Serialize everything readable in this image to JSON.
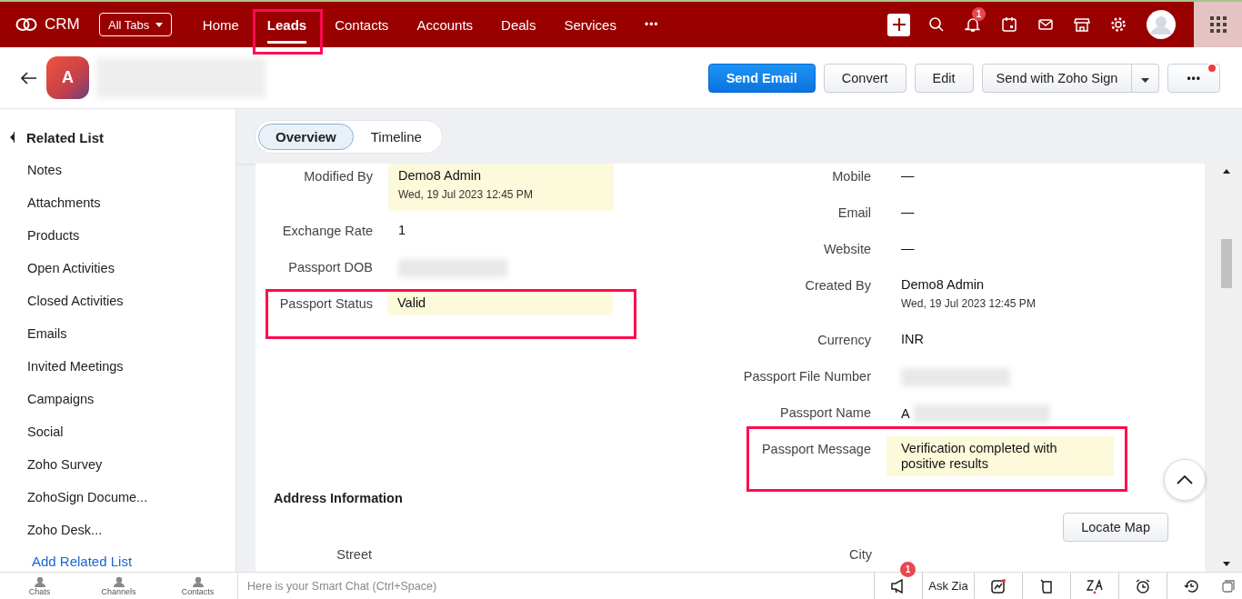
{
  "top_nav": {
    "logo_text": "CRM",
    "all_tabs": "All Tabs",
    "more": "•••",
    "notification_count": "1",
    "items": [
      {
        "label": "Home",
        "selected": false,
        "highlighted": false
      },
      {
        "label": "Leads",
        "selected": true,
        "highlighted": true
      },
      {
        "label": "Contacts",
        "selected": false,
        "highlighted": false
      },
      {
        "label": "Accounts",
        "selected": false,
        "highlighted": false
      },
      {
        "label": "Deals",
        "selected": false,
        "highlighted": false
      },
      {
        "label": "Services",
        "selected": false,
        "highlighted": false
      }
    ]
  },
  "record_header": {
    "avatar_letter": "A",
    "more": "•••",
    "more_has_alert": true,
    "actions": [
      {
        "label": "Send Email",
        "kind": "primary"
      },
      {
        "label": "Convert",
        "kind": "plain"
      },
      {
        "label": "Edit",
        "kind": "plain"
      },
      {
        "label": "Send with Zoho Sign",
        "kind": "split"
      }
    ]
  },
  "related_list": {
    "title": "Related List",
    "add_link": "Add Related List",
    "items": [
      "Notes",
      "Attachments",
      "Products",
      "Open Activities",
      "Closed Activities",
      "Emails",
      "Invited Meetings",
      "Campaigns",
      "Social",
      "Zoho Survey",
      "ZohoSign Docume...",
      "Zoho Desk..."
    ]
  },
  "view_tabs": [
    {
      "label": "Overview",
      "selected": true
    },
    {
      "label": "Timeline",
      "selected": false
    }
  ],
  "details": {
    "left": [
      {
        "label": "Modified By",
        "value": "Demo8 Admin",
        "subtext": "Wed, 19 Jul 2023 12:45 PM",
        "blurred": false,
        "tinted": true,
        "highlighted": false
      },
      {
        "label": "Exchange Rate",
        "value": "1",
        "blurred": false,
        "tinted": false,
        "highlighted": false
      },
      {
        "label": "Passport DOB",
        "blurred": true,
        "tinted": false,
        "highlighted": false
      },
      {
        "label": "Passport Status",
        "value": "Valid",
        "blurred": false,
        "tinted": true,
        "highlighted": true
      }
    ],
    "right": [
      {
        "label": "Mobile",
        "value": "—",
        "blurred": false,
        "tinted": false,
        "highlighted": false
      },
      {
        "label": "Email",
        "value": "—",
        "blurred": false,
        "tinted": false,
        "highlighted": false
      },
      {
        "label": "Website",
        "value": "—",
        "blurred": false,
        "tinted": false,
        "highlighted": false
      },
      {
        "label": "Created By",
        "value": "Demo8 Admin",
        "subtext": "Wed, 19 Jul 2023 12:45 PM",
        "blurred": false,
        "tinted": false,
        "highlighted": false
      },
      {
        "label": "Currency",
        "value": "INR",
        "blurred": false,
        "tinted": false,
        "highlighted": false
      },
      {
        "label": "Passport File Number",
        "blurred": true,
        "tinted": false,
        "highlighted": false
      },
      {
        "label": "Passport Name",
        "value": "A",
        "blurred": true,
        "tinted": false,
        "highlighted": false
      },
      {
        "label": "Passport Message",
        "value": "Verification completed with positive results",
        "blurred": false,
        "tinted": true,
        "highlighted": true
      }
    ]
  },
  "address_section": {
    "title": "Address Information",
    "button": "Locate Map",
    "left_label": "Street",
    "right_label": "City"
  },
  "bottom_bar": {
    "apps": [
      "Chats",
      "Channels",
      "Contacts"
    ],
    "chat_placeholder": "Here is your Smart Chat (Ctrl+Space)",
    "announcement_count": "1",
    "ask_zia": "Ask Zia"
  }
}
